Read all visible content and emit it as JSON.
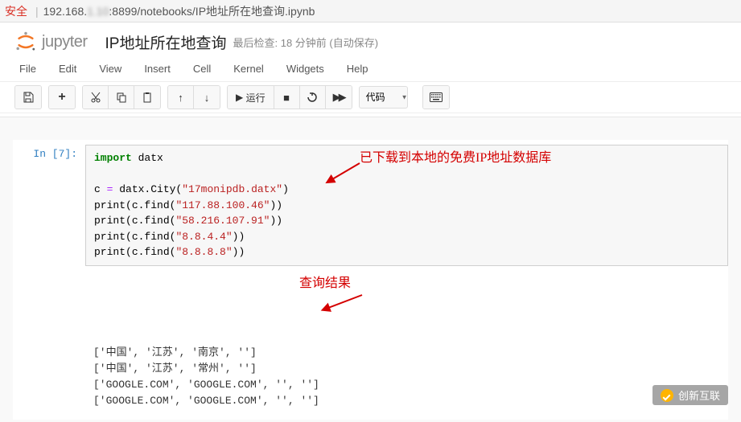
{
  "address_bar": {
    "warning": "安全",
    "sep": "|",
    "url_prefix": "192.168.",
    "url_blur": "1.10",
    "url_suffix": ":8899/notebooks/IP地址所在地查询.ipynb"
  },
  "header": {
    "logo_text": "jupyter",
    "notebook_title": "IP地址所在地查询",
    "checkpoint": "最后检查: 18 分钟前   (自动保存)"
  },
  "menubar": [
    "File",
    "Edit",
    "View",
    "Insert",
    "Cell",
    "Kernel",
    "Widgets",
    "Help"
  ],
  "toolbar": {
    "run_label": "运行",
    "celltype": "代码"
  },
  "cell": {
    "prompt": "In  [7]:",
    "code_lines": [
      [
        {
          "t": "import",
          "c": "kw"
        },
        {
          "t": " datx",
          "c": "nm"
        }
      ],
      [],
      [
        {
          "t": "c ",
          "c": "nm"
        },
        {
          "t": "=",
          "c": "op"
        },
        {
          "t": " datx.City(",
          "c": "nm"
        },
        {
          "t": "\"17monipdb.datx\"",
          "c": "str"
        },
        {
          "t": ")",
          "c": "nm"
        }
      ],
      [
        {
          "t": "print",
          "c": "nm"
        },
        {
          "t": "(c.find(",
          "c": "nm"
        },
        {
          "t": "\"117.88.100.46\"",
          "c": "str"
        },
        {
          "t": "))",
          "c": "nm"
        }
      ],
      [
        {
          "t": "print",
          "c": "nm"
        },
        {
          "t": "(c.find(",
          "c": "nm"
        },
        {
          "t": "\"58.216.107.91\"",
          "c": "str"
        },
        {
          "t": "))",
          "c": "nm"
        }
      ],
      [
        {
          "t": "print",
          "c": "nm"
        },
        {
          "t": "(c.find(",
          "c": "nm"
        },
        {
          "t": "\"8.8.4.4\"",
          "c": "str"
        },
        {
          "t": "))",
          "c": "nm"
        }
      ],
      [
        {
          "t": "print",
          "c": "nm"
        },
        {
          "t": "(c.find(",
          "c": "nm"
        },
        {
          "t": "\"8.8.8.8\"",
          "c": "str"
        },
        {
          "t": "))",
          "c": "nm"
        }
      ]
    ],
    "output_lines": [
      "['中国', '江苏', '南京', '']",
      "['中国', '江苏', '常州', '']",
      "['GOOGLE.COM', 'GOOGLE.COM', '', '']",
      "['GOOGLE.COM', 'GOOGLE.COM', '', '']"
    ]
  },
  "annotations": {
    "a1": "已下载到本地的免费IP地址数据库",
    "a2": "查询结果"
  },
  "watermark": "创新互联"
}
